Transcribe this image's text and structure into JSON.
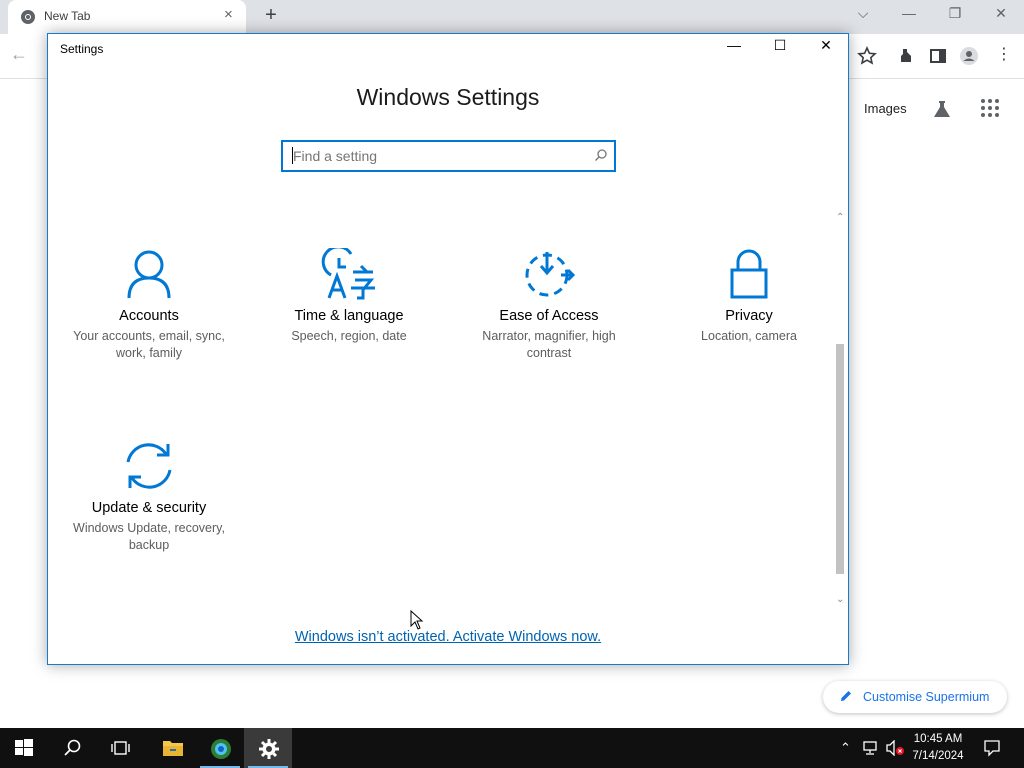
{
  "browser": {
    "tab_title": "New Tab",
    "tab_close": "×",
    "new_tab": "+",
    "images_link": "Images",
    "customise_label": "Customise Supermium"
  },
  "settings_window": {
    "title": "Settings",
    "heading": "Windows Settings",
    "search_placeholder": "Find a setting",
    "tiles": [
      {
        "name": "Accounts",
        "desc": "Your accounts, email, sync, work, family",
        "icon": "person-icon"
      },
      {
        "name": "Time & language",
        "desc": "Speech, region, date",
        "icon": "time-language-icon"
      },
      {
        "name": "Ease of Access",
        "desc": "Narrator, magnifier, high contrast",
        "icon": "ease-of-access-icon"
      },
      {
        "name": "Privacy",
        "desc": "Location, camera",
        "icon": "lock-icon"
      },
      {
        "name": "Update & security",
        "desc": "Windows Update, recovery, backup",
        "icon": "sync-icon"
      }
    ],
    "activation_link": "Windows isn’t activated. Activate Windows now."
  },
  "taskbar": {
    "time": "10:45 AM",
    "date": "7/14/2024"
  },
  "colors": {
    "accent": "#0078d4",
    "link": "#0063b1",
    "taskbar": "#101010"
  }
}
